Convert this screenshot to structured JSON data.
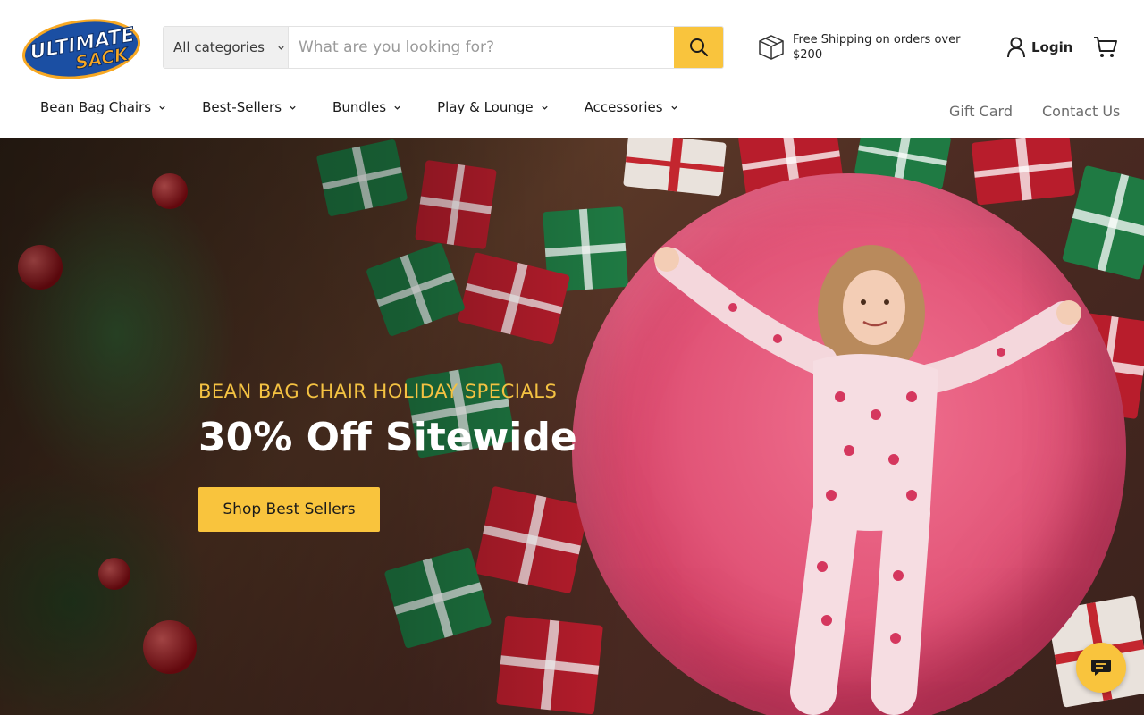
{
  "brand": {
    "logo_line1": "Ultimate",
    "logo_line2": "Sack",
    "colors": {
      "accent": "#f9c43d",
      "logo_blue": "#1b4fa3",
      "logo_orange": "#f7a823"
    }
  },
  "search": {
    "category_label": "All categories",
    "placeholder": "What are you looking for?",
    "button_icon": "search-icon"
  },
  "shipping": {
    "icon": "package-icon",
    "text": "Free Shipping on orders over $200"
  },
  "account": {
    "login_label": "Login",
    "cart_icon": "cart-icon"
  },
  "nav": {
    "items": [
      {
        "label": "Bean Bag Chairs"
      },
      {
        "label": "Best-Sellers"
      },
      {
        "label": "Bundles"
      },
      {
        "label": "Play & Lounge"
      },
      {
        "label": "Accessories"
      }
    ],
    "right": {
      "gift_card": "Gift Card",
      "contact": "Contact Us"
    }
  },
  "hero": {
    "kicker": "BEAN BAG CHAIR HOLIDAY SPECIALS",
    "title": "30% Off Sitewide",
    "cta": "Shop Best Sellers"
  },
  "chat": {
    "icon": "chat-icon"
  }
}
